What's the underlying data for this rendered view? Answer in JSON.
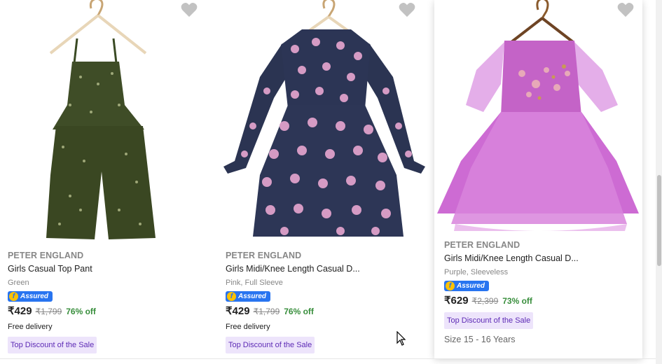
{
  "products": [
    {
      "brand": "PETER ENGLAND",
      "title": "Girls Casual Top Pant",
      "variant": "Green",
      "assured": "Assured",
      "price": "₹429",
      "mrp": "₹1,799",
      "discount": "76% off",
      "delivery": "Free delivery",
      "badge": "Top Discount of the Sale",
      "image_alt": "green-floral-jumpsuit"
    },
    {
      "brand": "PETER ENGLAND",
      "title": "Girls Midi/Knee Length Casual D...",
      "variant": "Pink, Full Sleeve",
      "assured": "Assured",
      "price": "₹429",
      "mrp": "₹1,799",
      "discount": "76% off",
      "delivery": "Free delivery",
      "badge": "Top Discount of the Sale",
      "image_alt": "pink-navy-floral-dress"
    },
    {
      "brand": "PETER ENGLAND",
      "title": "Girls Midi/Knee Length Casual D...",
      "variant": "Purple, Sleeveless",
      "assured": "Assured",
      "price": "₹629",
      "mrp": "₹2,399",
      "discount": "73% off",
      "badge": "Top Discount of the Sale",
      "size_label": "Size",
      "size_value": "15 - 16 Years",
      "image_alt": "purple-tulle-dress"
    }
  ],
  "colors": {
    "accent_blue": "#2874f0",
    "discount_green": "#388e3c",
    "badge_bg": "#ede4fb",
    "badge_text": "#5d2ab5"
  }
}
